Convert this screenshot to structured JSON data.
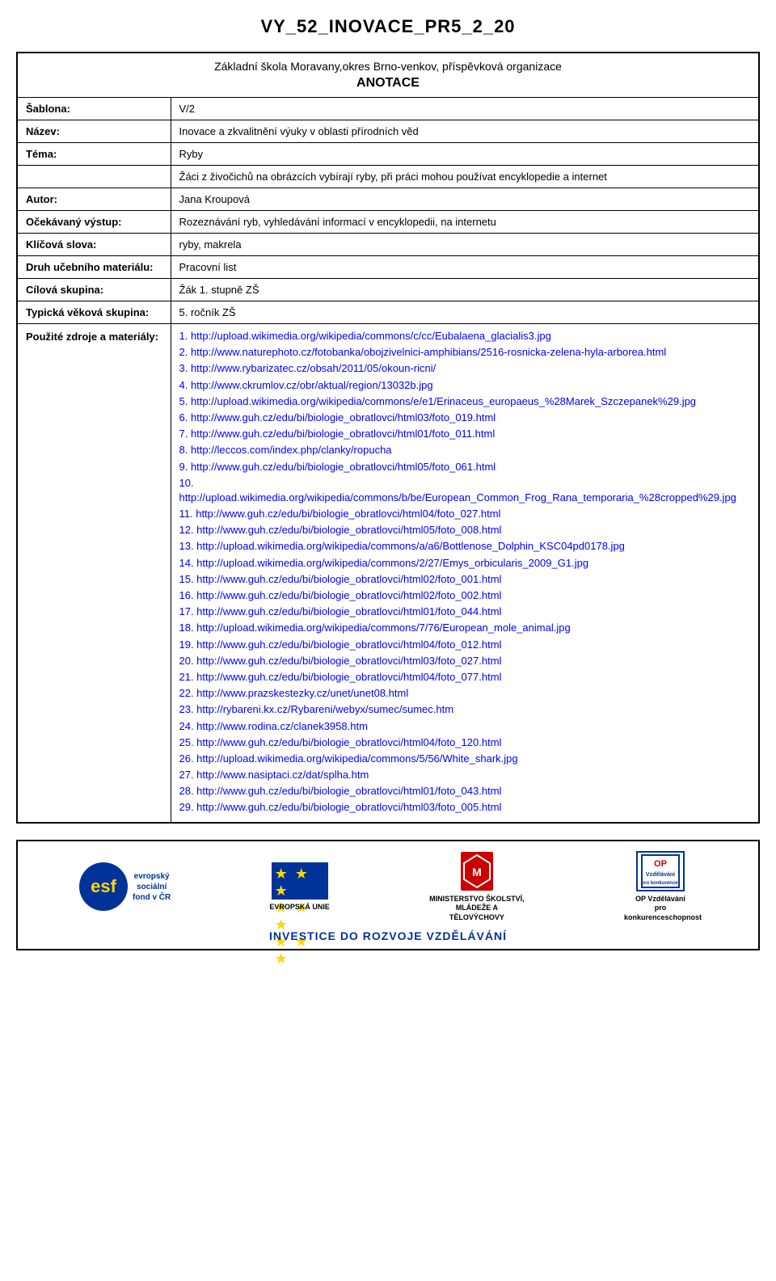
{
  "title": "VY_52_INOVACE_PR5_2_20",
  "school": "Základní škola Moravany,okres Brno-venkov, příspěvková organizace",
  "section_header": "ANOTACE",
  "rows": [
    {
      "label": "Šablona:",
      "value": "V/2"
    },
    {
      "label": "Název:",
      "value": "Inovace a zkvalitnění výuky v oblasti přírodních věd"
    },
    {
      "label": "Téma:",
      "value": "Ryby"
    },
    {
      "label": "",
      "value": "Žáci z živočichů na obrázcích vybírají ryby, při práci mohou používat encyklopedie a internet"
    },
    {
      "label": "Autor:",
      "value": "Jana Kroupová"
    },
    {
      "label": "Očekávaný výstup:",
      "value": "Rozeznávání ryb, vyhledávání informací v encyklopedii, na internetu"
    },
    {
      "label": "Klíčová slova:",
      "value": "ryby, makrela"
    },
    {
      "label": "Druh učebního materiálu:",
      "value": "Pracovní list"
    },
    {
      "label": "Cílová skupina:",
      "value": "Žák 1. stupně ZŠ"
    },
    {
      "label": "Typická věková skupina:",
      "value": "5. ročník ZŠ"
    }
  ],
  "sources_label": "Použité zdroje a materiály:",
  "sources": [
    "1. http://upload.wikimedia.org/wikipedia/commons/c/cc/Eubalaena_glacialis3.jpg",
    "2. http://www.naturephoto.cz/fotobanka/obojzivelnici-amphibians/2516-rosnicka-zelena-hyla-arborea.html",
    "3. http://www.rybarizatec.cz/obsah/2011/05/okoun-ricni/",
    "4. http://www.ckrumlov.cz/obr/aktual/region/13032b.jpg",
    "5. http://upload.wikimedia.org/wikipedia/commons/e/e1/Erinaceus_europaeus_%28Marek_Szczepanek%29.jpg",
    "6. http://www.guh.cz/edu/bi/biologie_obratlovci/html03/foto_019.html",
    "7. http://www.guh.cz/edu/bi/biologie_obratlovci/html01/foto_011.html",
    "8. http://leccos.com/index.php/clanky/ropucha",
    "9. http://www.guh.cz/edu/bi/biologie_obratlovci/html05/foto_061.html",
    "10. http://upload.wikimedia.org/wikipedia/commons/b/be/European_Common_Frog_Rana_temporaria_%28cropped%29.jpg",
    "11. http://www.guh.cz/edu/bi/biologie_obratlovci/html04/foto_027.html",
    "12. http://www.guh.cz/edu/bi/biologie_obratlovci/html05/foto_008.html",
    "13. http://upload.wikimedia.org/wikipedia/commons/a/a6/Bottlenose_Dolphin_KSC04pd0178.jpg",
    "14. http://upload.wikimedia.org/wikipedia/commons/2/27/Emys_orbicularis_2009_G1.jpg",
    "15. http://www.guh.cz/edu/bi/biologie_obratlovci/html02/foto_001.html",
    "16. http://www.guh.cz/edu/bi/biologie_obratlovci/html02/foto_002.html",
    "17. http://www.guh.cz/edu/bi/biologie_obratlovci/html01/foto_044.html",
    "18. http://upload.wikimedia.org/wikipedia/commons/7/76/European_mole_animal.jpg",
    "19. http://www.guh.cz/edu/bi/biologie_obratlovci/html04/foto_012.html",
    "20. http://www.guh.cz/edu/bi/biologie_obratlovci/html03/foto_027.html",
    "21. http://www.guh.cz/edu/bi/biologie_obratlovci/html04/foto_077.html",
    "22. http://www.prazskestezky.cz/unet/unet08.html",
    "23. http://rybareni.kx.cz/Rybareni/webyx/sumec/sumec.htm",
    "24. http://www.rodina.cz/clanek3958.htm",
    "25. http://www.guh.cz/edu/bi/biologie_obratlovci/html04/foto_120.html",
    "26. http://upload.wikimedia.org/wikipedia/commons/5/56/White_shark.jpg",
    "27. http://www.nasiptaci.cz/dat/splha.htm",
    "28. http://www.guh.cz/edu/bi/biologie_obratlovci/html01/foto_043.html",
    "29. http://www.guh.cz/edu/bi/biologie_obratlovci/html03/foto_005.html"
  ],
  "footer": {
    "esf_label": "esf",
    "esf_subtext": "evropský\nsociální\nfond v ČR",
    "eu_label": "EVROPSKÁ UNIE",
    "msmt_label": "MINISTERSTVO ŠKOLSTVÍ,\nMLÁDEŽE A TĚLOVÝCHOVY",
    "op_label": "OP Vzdělávání\npro\nkonkurenceschopnost",
    "investice": "INVESTICE DO ROZVOJE VZDĚLÁVÁNÍ"
  }
}
